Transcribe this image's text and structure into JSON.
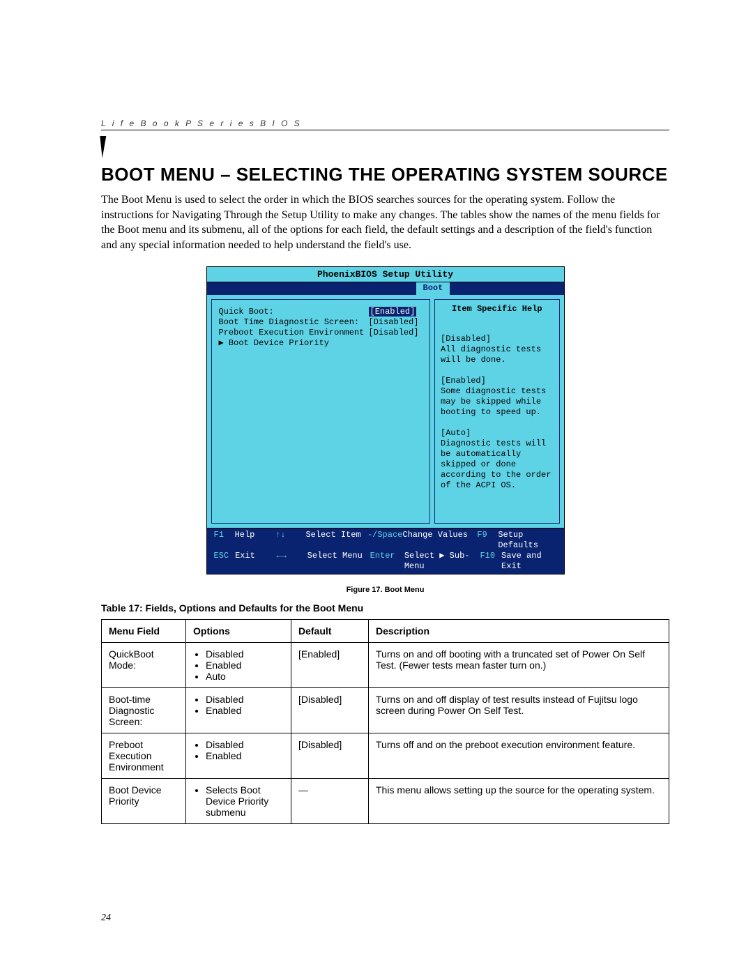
{
  "header_line": "L i f e B o o k   P   S e r i e s   B I O S",
  "title": "BOOT MENU – SELECTING THE OPERATING SYSTEM SOURCE",
  "intro": "The Boot Menu is used to select the order in which the BIOS searches sources for the operating system. Follow the instructions for Navigating Through the Setup Utility to make any changes. The tables show the names of the menu fields for the Boot menu and its submenu, all of the options for each field, the default settings and a description of the field's function and any special information needed to help understand the field's use.",
  "bios": {
    "utility_title": "PhoenixBIOS Setup Utility",
    "active_tab": "Boot",
    "left_items": [
      {
        "label": "Quick Boot:",
        "value": "[Enabled]",
        "selected": true
      },
      {
        "label": "Boot Time Diagnostic Screen:",
        "value": "[Disabled]",
        "selected": false
      },
      {
        "label": "",
        "value": "",
        "selected": false
      },
      {
        "label": "Preboot Execution Environment",
        "value": "[Disabled]",
        "selected": false
      },
      {
        "label": "▶ Boot Device Priority",
        "value": "",
        "selected": false
      }
    ],
    "help_title": "Item Specific Help",
    "help_body": "[Disabled]\nAll diagnostic tests will be done.\n\n[Enabled]\nSome diagnostic tests may be skipped while booting to speed up.\n\n[Auto]\nDiagnostic tests will be automatically skipped or done according to the order of the ACPI OS.",
    "footer": {
      "l1": {
        "k1": "F1",
        "t1": "Help",
        "k2": "↑↓",
        "t2": "Select Item",
        "k3": "-/Space",
        "t3": "Change Values",
        "k4": "F9",
        "t4": "Setup Defaults"
      },
      "l2": {
        "k1": "ESC",
        "t1": "Exit",
        "k2": "←→",
        "t2": "Select Menu",
        "k3": "Enter",
        "t3": "Select ▶ Sub-Menu",
        "k4": "F10",
        "t4": "Save and Exit"
      }
    }
  },
  "figure_caption": "Figure 17.  Boot Menu",
  "table_title": "Table 17: Fields, Options and Defaults for the Boot Menu",
  "table": {
    "headers": [
      "Menu Field",
      "Options",
      "Default",
      "Description"
    ],
    "rows": [
      {
        "menu_field": "QuickBoot Mode:",
        "options": [
          "Disabled",
          "Enabled",
          "Auto"
        ],
        "default": "[Enabled]",
        "description": "Turns on and off booting with a truncated set of Power On Self Test. (Fewer tests mean faster turn on.)"
      },
      {
        "menu_field": "Boot-time Diagnostic Screen:",
        "options": [
          "Disabled",
          "Enabled"
        ],
        "default": "[Disabled]",
        "description": "Turns on and off display of test results instead of Fujitsu logo screen during Power On Self Test."
      },
      {
        "menu_field": "Preboot Execution Environment",
        "options": [
          "Disabled",
          "Enabled"
        ],
        "default": "[Disabled]",
        "description": "Turns off and on the preboot execution environment feature."
      },
      {
        "menu_field": "Boot Device Priority",
        "options": [
          "Selects Boot Device Priority submenu"
        ],
        "default": "—",
        "description": "This menu allows setting up the source for the operating system."
      }
    ]
  },
  "page_number": "24"
}
